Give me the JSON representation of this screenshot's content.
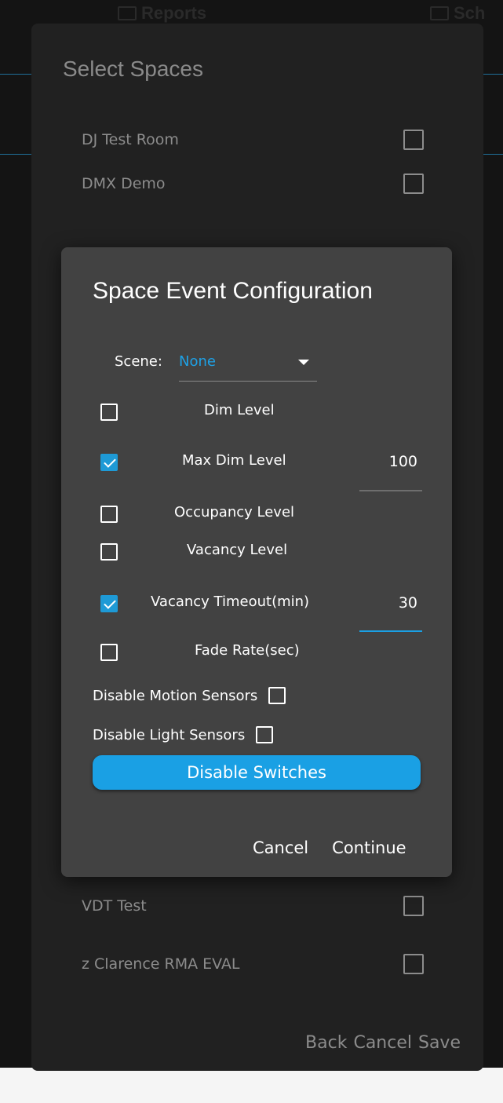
{
  "app": {
    "tabs": [
      {
        "label": "Reports",
        "icon": "bar-chart-icon"
      },
      {
        "label": "Sch",
        "icon": "calendar-icon"
      }
    ]
  },
  "select_spaces": {
    "title": "Select Spaces",
    "spaces": [
      {
        "label": "DJ Test Room",
        "checked": false
      },
      {
        "label": "DMX Demo",
        "checked": false
      },
      {
        "label": "VDT Test",
        "checked": false
      },
      {
        "label": "z Clarence RMA EVAL",
        "checked": false
      }
    ],
    "actions": {
      "back": "Back",
      "cancel": "Cancel",
      "save": "Save"
    }
  },
  "event_config": {
    "title": "Space Event Configuration",
    "scene": {
      "label": "Scene:",
      "value": "None"
    },
    "options": [
      {
        "label": "Dim Level",
        "checked": false,
        "value": ""
      },
      {
        "label": "Max Dim Level",
        "checked": true,
        "value": "100"
      },
      {
        "label": "Occupancy Level",
        "checked": false,
        "value": ""
      },
      {
        "label": "Vacancy Level",
        "checked": false,
        "value": ""
      },
      {
        "label": "Vacancy Timeout(min)",
        "checked": true,
        "value": "30"
      },
      {
        "label": "Fade Rate(sec)",
        "checked": false,
        "value": ""
      }
    ],
    "disable_motion": {
      "label": "Disable Motion Sensors",
      "checked": false
    },
    "disable_light": {
      "label": "Disable Light Sensors",
      "checked": false
    },
    "disable_switches_label": "Disable Switches",
    "actions": {
      "cancel": "Cancel",
      "continue": "Continue"
    }
  },
  "colors": {
    "accent": "#1aa0e4",
    "dialog_bg": "#424242",
    "outer_dialog_bg": "#212121",
    "muted_text": "#8c8c8c",
    "scene_value": "#1ea1e6"
  }
}
